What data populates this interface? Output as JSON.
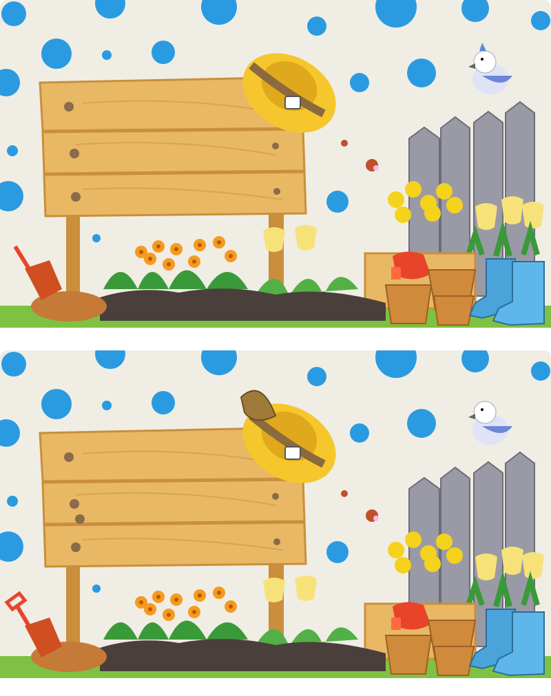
{
  "game": {
    "type": "spot-the-difference",
    "panels": [
      {
        "id": "original",
        "variant": "top"
      },
      {
        "id": "altered",
        "variant": "bottom"
      }
    ]
  },
  "colors": {
    "background": "#f0ede4",
    "dots": "#2a9be0",
    "grass": "#7fc142",
    "wood": "#e8b865",
    "wood_grain": "#c98f3c",
    "soil": "#4a3f3b",
    "fence": "#9a9aa6",
    "boot": "#4aa3d9",
    "hat": "#f5c72c",
    "hat_band": "#8b6a3e",
    "pot": "#d08a3c",
    "glove": "#e8442a",
    "tulip": "#f7e27a",
    "flower_orange": "#f59a1f",
    "flower_yellow": "#f5d21c"
  },
  "icons": {
    "sign": "wooden-sign-icon",
    "hat": "straw-hat-icon",
    "bird": "bird-icon",
    "shovel": "shovel-icon",
    "boots": "rain-boots-icon",
    "gloves": "gloves-icon",
    "pots": "flower-pot-icon",
    "butterfly": "butterfly-icon",
    "fence": "fence-icon",
    "feather": "feather-icon"
  }
}
